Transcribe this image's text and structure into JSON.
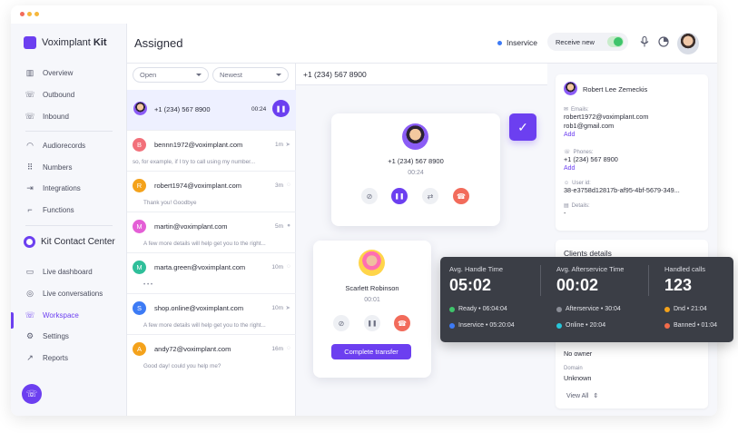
{
  "colors": {
    "accent": "#6c3ff0",
    "ready": "#3ec46b",
    "inservice": "#3d7bf5",
    "afterservice": "#8a8d96",
    "online": "#26c6da",
    "dnd": "#f4a21b",
    "banned": "#f26b4a",
    "hangup": "#f26b5b"
  },
  "sidebar": {
    "brand_voximplant": {
      "prefix": "Voximplant",
      "suffix": "Kit"
    },
    "nav_top": [
      {
        "label": "Overview",
        "icon": "overview-icon"
      },
      {
        "label": "Outbound",
        "icon": "outbound-icon"
      },
      {
        "label": "Inbound",
        "icon": "inbound-icon"
      }
    ],
    "nav_mid": [
      {
        "label": "Audiorecords",
        "icon": "headphones-icon"
      },
      {
        "label": "Numbers",
        "icon": "dialpad-icon"
      },
      {
        "label": "Integrations",
        "icon": "integrations-icon"
      },
      {
        "label": "Functions",
        "icon": "functions-icon"
      }
    ],
    "brand_contact": "Kit Contact Center",
    "nav_bottom": [
      {
        "label": "Live dashboard",
        "icon": "dashboard-icon"
      },
      {
        "label": "Live conversations",
        "icon": "conversations-icon"
      },
      {
        "label": "Workspace",
        "icon": "workspace-icon",
        "active": true
      },
      {
        "label": "Settings",
        "icon": "gear-icon"
      },
      {
        "label": "Reports",
        "icon": "reports-icon"
      }
    ]
  },
  "topbar": {
    "title": "Assigned",
    "status": "Inservice",
    "receive_new": "Receive new"
  },
  "list": {
    "filter_status": "Open",
    "filter_sort": "Newest",
    "active_call": {
      "number": "+1 (234) 567 8900",
      "timer": "00:24"
    },
    "rows": [
      {
        "initial": "B",
        "color": "#f2707a",
        "name": "bennn1972@voximplant.com",
        "time": "1m",
        "preview": "so, for example, if I try to call using my number..."
      },
      {
        "initial": "R",
        "color": "#f4a21b",
        "name": "robert1974@voximplant.com",
        "time": "3m",
        "preview": "Thank you! Goodbye"
      },
      {
        "initial": "M",
        "color": "#e45fd6",
        "name": "martin@voximplant.com",
        "time": "5m",
        "preview": "A few more details will help get you to the right..."
      },
      {
        "initial": "M",
        "color": "#2fbf9a",
        "name": "marta.green@voximplant.com",
        "time": "10m",
        "preview": "• • •"
      },
      {
        "initial": "S",
        "color": "#3d7bf5",
        "name": "shop.online@voximplant.com",
        "time": "10m",
        "preview": "A few more details will help get you to the right..."
      },
      {
        "initial": "A",
        "color": "#f4a21b",
        "name": "andy72@voximplant.com",
        "time": "16m",
        "preview": "Good day! could you help me?"
      }
    ]
  },
  "conversation": {
    "header_number": "+1 (234) 567 8900",
    "call_card": {
      "number": "+1 (234) 567 8900",
      "timer": "00:24"
    },
    "transfer_card": {
      "name": "Scarlett Robinson",
      "timer": "00:01",
      "button": "Complete transfer"
    }
  },
  "details": {
    "contact_name": "Robert Lee Zemeckis",
    "emails_label": "Emails:",
    "emails": [
      "robert1972@voximplant.com",
      "rob1@gmail.com"
    ],
    "add_label": "Add",
    "phones_label": "Phones:",
    "phones": [
      "+1 (234) 567 8900"
    ],
    "user_id_label": "User id:",
    "user_id": "38-e3758d12817b-af95-4bf-5679-349...",
    "details_label": "Details:",
    "details_value": "-",
    "clients_title": "Clients details",
    "owner": "No owner",
    "domain_label": "Domain",
    "domain_value": "Unknown",
    "view_all": "View All"
  },
  "metrics": {
    "handle": {
      "label": "Avg. Handle Time",
      "value": "05:02",
      "sub1": "Ready • 06:04:04",
      "sub2": "Inservice • 05:20:04"
    },
    "after": {
      "label": "Avg. Afterservice Time",
      "value": "00:02",
      "sub1": "Afterservice • 30:04",
      "sub2": "Online • 20:04"
    },
    "handled": {
      "label": "Handled calls",
      "value": "123",
      "sub1": "Dnd • 21:04",
      "sub2": "Banned • 01:04"
    }
  }
}
